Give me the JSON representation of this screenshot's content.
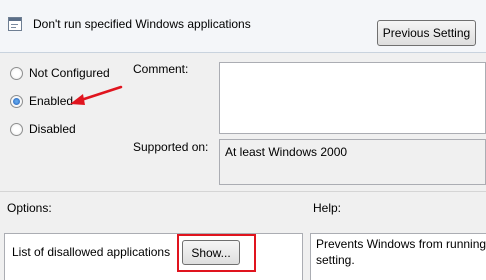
{
  "window": {
    "title": "Don't run specified Windows applications",
    "previous_setting_label": "Previous Setting"
  },
  "state": {
    "options": [
      {
        "label": "Not Configured",
        "selected": false
      },
      {
        "label": "Enabled",
        "selected": true
      },
      {
        "label": "Disabled",
        "selected": false
      }
    ]
  },
  "comment": {
    "label": "Comment:",
    "value": ""
  },
  "supported": {
    "label": "Supported on:",
    "value": "At least Windows 2000"
  },
  "options_pane": {
    "label": "Options:",
    "item_label": "List of disallowed applications",
    "show_button": "Show..."
  },
  "help_pane": {
    "label": "Help:",
    "line1": "Prevents Windows from running",
    "line2": "setting."
  },
  "colors": {
    "annotation_red": "#e0141e",
    "radio_selected": "#1a55b0"
  },
  "icons": {
    "title": "policy-setting-icon",
    "annotation": "red-arrow-icon"
  }
}
